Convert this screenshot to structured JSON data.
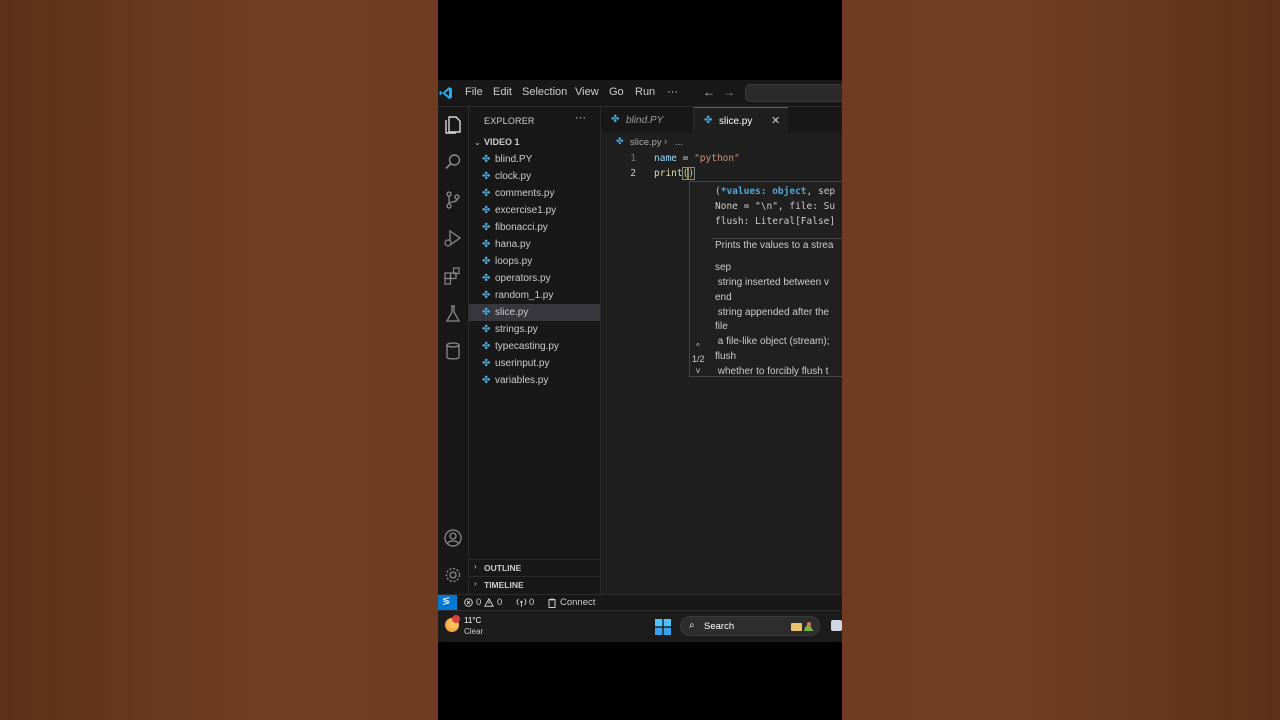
{
  "menu": {
    "items": [
      "File",
      "Edit",
      "Selection",
      "View",
      "Go",
      "Run"
    ],
    "more": "···",
    "back": "←",
    "forward": "→"
  },
  "sidebar": {
    "title": "EXPLORER",
    "more": "···",
    "folder": "VIDEO 1",
    "files": [
      "blind.PY",
      "clock.py",
      "comments.py",
      "excercise1.py",
      "fibonacci.py",
      "hana.py",
      "loops.py",
      "operators.py",
      "random_1.py",
      "slice.py",
      "strings.py",
      "typecasting.py",
      "userinput.py",
      "variables.py"
    ],
    "active_file": "slice.py",
    "outline_label": "OUTLINE",
    "timeline_label": "TIMELINE"
  },
  "tabs": [
    {
      "label": "blind.PY",
      "active": false
    },
    {
      "label": "slice.py",
      "active": true
    }
  ],
  "tab_close": "✕",
  "breadcrumb": {
    "file": "slice.py",
    "separator": "›",
    "rest": "..."
  },
  "code": {
    "line_numbers": [
      "1",
      "2"
    ],
    "line1": {
      "var": "name",
      "op": " = ",
      "str": "\"python\""
    },
    "line2": {
      "fn": "print",
      "paren_open": "(",
      "paren_close": ")"
    }
  },
  "signature": {
    "line1_open": "(",
    "line1_param": "*values: object",
    "line1_rest": ", sep",
    "line2": "None = \"\\n\", file: Su",
    "line3": "flush: Literal[False]",
    "description": "Prints the values to a strea",
    "params": [
      {
        "name": "sep",
        "desc": " string inserted between v"
      },
      {
        "name": "end",
        "desc": " string appended after the"
      },
      {
        "name": "file",
        "desc": " a file-like object (stream);"
      },
      {
        "name": "flush",
        "desc": " whether to forcibly flush t"
      }
    ],
    "overload_counter": "1/2",
    "up": "^",
    "down": "v"
  },
  "statusbar": {
    "remote_glyph": "≶",
    "errors": "0",
    "warnings": "0",
    "ports": "0",
    "connect": "Connect"
  },
  "taskbar": {
    "temperature": "11°C",
    "condition": "Clear",
    "search_label": "Search",
    "search_glyph": "⌕"
  },
  "colors": {
    "accent": "#0078d4",
    "python_icon": "#4fa7d8",
    "string": "#ce9178",
    "function": "#dcdcaa",
    "variable": "#9cdcfe",
    "bracket": "#ffd700"
  }
}
